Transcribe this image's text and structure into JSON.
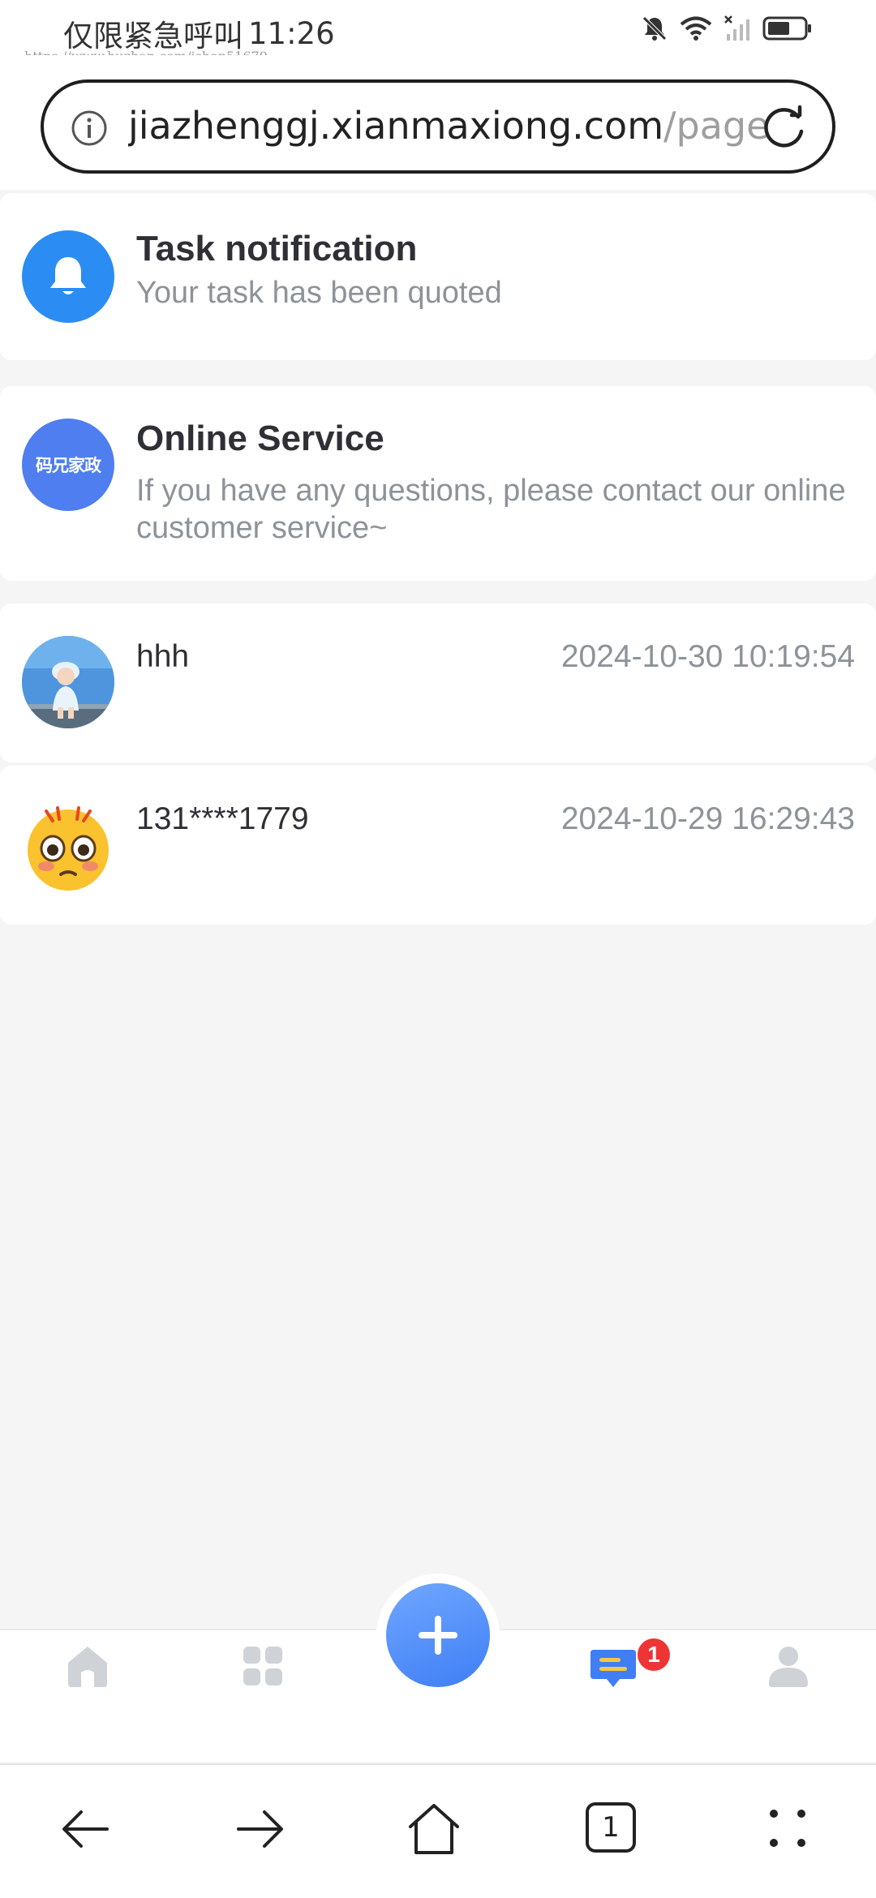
{
  "status_bar": {
    "carrier": "仅限紧急呼叫",
    "time": "11:26",
    "watermark": "https://www.huzhan.com/ishop51679"
  },
  "address_bar": {
    "url_host": "jiazhenggj.xianmaxiong.com",
    "url_path": "/page"
  },
  "notifications": {
    "task": {
      "title": "Task notification",
      "description": "Your task has been quoted"
    },
    "service": {
      "avatar_text": "码兄家政",
      "title": "Online Service",
      "description": "If you have any questions, please contact our online customer service~"
    }
  },
  "conversations": [
    {
      "name": "hhh",
      "time": "2024-10-30 10:19:54"
    },
    {
      "name": "131****1779",
      "time": "2024-10-29 16:29:43"
    }
  ],
  "bottom_nav": {
    "message_badge": "1",
    "active_color": "#3f7ef5",
    "inactive_color": "#cfd2d6"
  },
  "browser_toolbar": {
    "tab_count": "1"
  }
}
